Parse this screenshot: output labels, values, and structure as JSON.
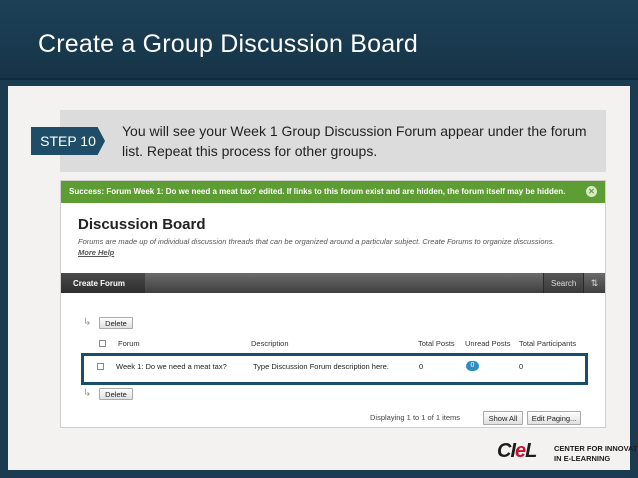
{
  "slide": {
    "title": "Create a Group Discussion Board",
    "step_label": "STEP 10",
    "step_text": "You will see your Week 1 Group Discussion Forum appear under the forum list. Repeat this process for other groups."
  },
  "screenshot": {
    "success_message": "Success: Forum Week 1: Do we need a meat tax? edited. If links to this forum exist and are hidden, the forum itself may be hidden.",
    "close_icon": "✕",
    "board_title": "Discussion Board",
    "board_description": "Forums are made up of individual discussion threads that can be organized around a particular subject. Create Forums to organize discussions.",
    "more_help": "More Help",
    "create_forum_label": "Create Forum",
    "search_label": "Search",
    "sort_icon": "⇅",
    "delete_label_top": "Delete",
    "delete_label_bottom": "Delete",
    "columns": {
      "forum": "Forum",
      "description": "Description",
      "total_posts": "Total Posts",
      "unread_posts": "Unread Posts",
      "total_participants": "Total Participants"
    },
    "row": {
      "forum": "Week 1: Do we need a meat tax?",
      "description": "Type Discussion Forum description here.",
      "total_posts": "0",
      "unread_posts": "0",
      "total_participants": "0"
    },
    "paging_text": "Displaying 1 to 1 of 1 items",
    "show_all_label": "Show All",
    "edit_paging_label": "Edit Paging..."
  },
  "logo": {
    "mark_prefix": "CI",
    "mark_accent": "e",
    "mark_suffix": "L",
    "line1": "CENTER FOR INNOVATION",
    "line2": "IN E-LEARNING"
  },
  "colors": {
    "header_bg": "#1d4058",
    "success_bg": "#5e9c34",
    "highlight_border": "#1b4e6a",
    "unread_badge": "#2c8ec3",
    "logo_accent": "#c8102e"
  }
}
